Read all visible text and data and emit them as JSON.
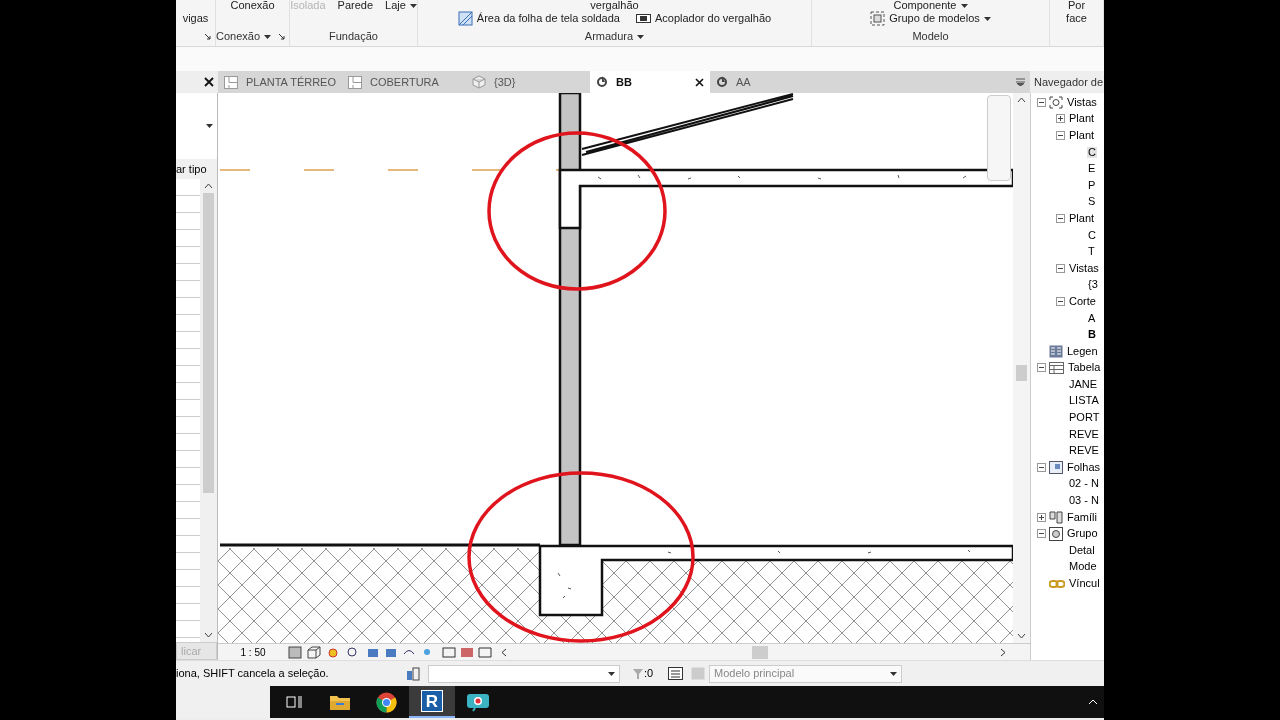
{
  "ribbon": {
    "panels": [
      {
        "middle_tools": [
          {
            "label": "vigas",
            "disabled": false
          }
        ]
      },
      {
        "label": "Conexão",
        "top_tools": [
          {
            "label": "Conexão",
            "disabled": false
          }
        ]
      },
      {
        "label": "Fundação",
        "top_tools": [
          {
            "label": "Isolada",
            "disabled": true
          },
          {
            "label": "Parede",
            "disabled": false
          },
          {
            "label": "Laje",
            "disabled": false
          }
        ]
      },
      {
        "label": "Armadura",
        "top_tools": [
          {
            "label": "vergalhão",
            "disabled": false
          }
        ],
        "middle_tools": [
          {
            "label": "Área  da folha de tela soldada",
            "kind": "mesh",
            "disabled": false
          },
          {
            "label": "Acoplador do  vergalhão",
            "kind": "coupler",
            "disabled": false
          }
        ]
      },
      {
        "label": "Modelo",
        "top_tools": [
          {
            "label": "Componente",
            "disabled": false
          }
        ],
        "middle_tools": [
          {
            "label": "Grupo de  modelos",
            "kind": "group",
            "disabled": false
          }
        ]
      },
      {
        "top_tools": [
          {
            "label": "Por",
            "disabled": false
          }
        ],
        "middle_tools": [
          {
            "label": "face",
            "disabled": false
          }
        ]
      }
    ]
  },
  "properties": {
    "type_label": "ar tipo",
    "apply_button": {
      "label": "licar",
      "disabled": true
    }
  },
  "tabs": [
    {
      "label": "PLANTA TÉRREO",
      "kind": "plan",
      "selected": false
    },
    {
      "label": "COBERTURA",
      "kind": "plan",
      "selected": false
    },
    {
      "label": "{3D}",
      "kind": "cube",
      "selected": false
    },
    {
      "label": "BB",
      "kind": "section",
      "selected": true
    },
    {
      "label": "AA",
      "kind": "section",
      "selected": false
    }
  ],
  "view": {
    "scale": "1 : 50"
  },
  "project_browser": {
    "title": "Navegador de",
    "items": [
      {
        "label": "Vistas",
        "kind": "views",
        "expanded": true,
        "selected": false,
        "bold": false,
        "children": [
          {
            "label": "Plant",
            "expanded": false,
            "selected": false,
            "bold": false
          },
          {
            "label": "Plant",
            "expanded": true,
            "selected": false,
            "bold": false,
            "children": [
              {
                "label": "C",
                "selected": true,
                "bold": false
              },
              {
                "label": "E",
                "selected": false,
                "bold": false
              },
              {
                "label": "P",
                "selected": false,
                "bold": false
              },
              {
                "label": "S",
                "selected": false,
                "bold": false
              }
            ]
          },
          {
            "label": "Plant",
            "expanded": true,
            "selected": false,
            "bold": false,
            "children": [
              {
                "label": "C",
                "selected": false,
                "bold": false
              },
              {
                "label": "T",
                "selected": false,
                "bold": false
              }
            ]
          },
          {
            "label": "Vistas",
            "expanded": true,
            "selected": false,
            "bold": false,
            "children": [
              {
                "label": "{3",
                "selected": false,
                "bold": false
              }
            ]
          },
          {
            "label": "Corte",
            "expanded": true,
            "selected": false,
            "bold": false,
            "children": [
              {
                "label": "A",
                "selected": false,
                "bold": false
              },
              {
                "label": "B",
                "selected": false,
                "bold": true
              }
            ]
          }
        ]
      },
      {
        "label": "Legen",
        "kind": "legend",
        "selected": false,
        "bold": false
      },
      {
        "label": "Tabela",
        "kind": "table",
        "expanded": true,
        "selected": false,
        "bold": false,
        "children": [
          {
            "label": "JANE",
            "selected": false,
            "bold": false
          },
          {
            "label": "LISTA",
            "selected": false,
            "bold": false
          },
          {
            "label": "PORT",
            "selected": false,
            "bold": false
          },
          {
            "label": "REVE",
            "selected": false,
            "bold": false
          },
          {
            "label": "REVE",
            "selected": false,
            "bold": false
          }
        ]
      },
      {
        "label": "Folhas",
        "kind": "sheets",
        "expanded": true,
        "selected": false,
        "bold": false,
        "children": [
          {
            "label": "02 - N",
            "selected": false,
            "bold": false
          },
          {
            "label": "03 - N",
            "selected": false,
            "bold": false
          }
        ]
      },
      {
        "label": "Famíli",
        "kind": "families",
        "expanded": false,
        "selected": false,
        "bold": false
      },
      {
        "label": "Grupo",
        "kind": "groups",
        "expanded": true,
        "selected": false,
        "bold": false,
        "children": [
          {
            "label": "Detal",
            "selected": false,
            "bold": false
          },
          {
            "label": "Mode",
            "selected": false,
            "bold": false
          }
        ]
      },
      {
        "label": "Víncul",
        "kind": "links",
        "selected": false,
        "bold": false
      }
    ]
  },
  "status_bar": {
    "message": "iona, SHIFT cancela a seleção.",
    "count": ":0",
    "workset": {
      "value": "Modelo principal",
      "disabled": true
    }
  },
  "taskbar": {
    "apps": [
      {
        "kind": "taskview",
        "selected": false
      },
      {
        "kind": "folder",
        "selected": false
      },
      {
        "kind": "browser",
        "selected": false
      },
      {
        "kind": "letter",
        "label": "R",
        "selected": true
      },
      {
        "kind": "camera",
        "selected": false
      }
    ]
  }
}
